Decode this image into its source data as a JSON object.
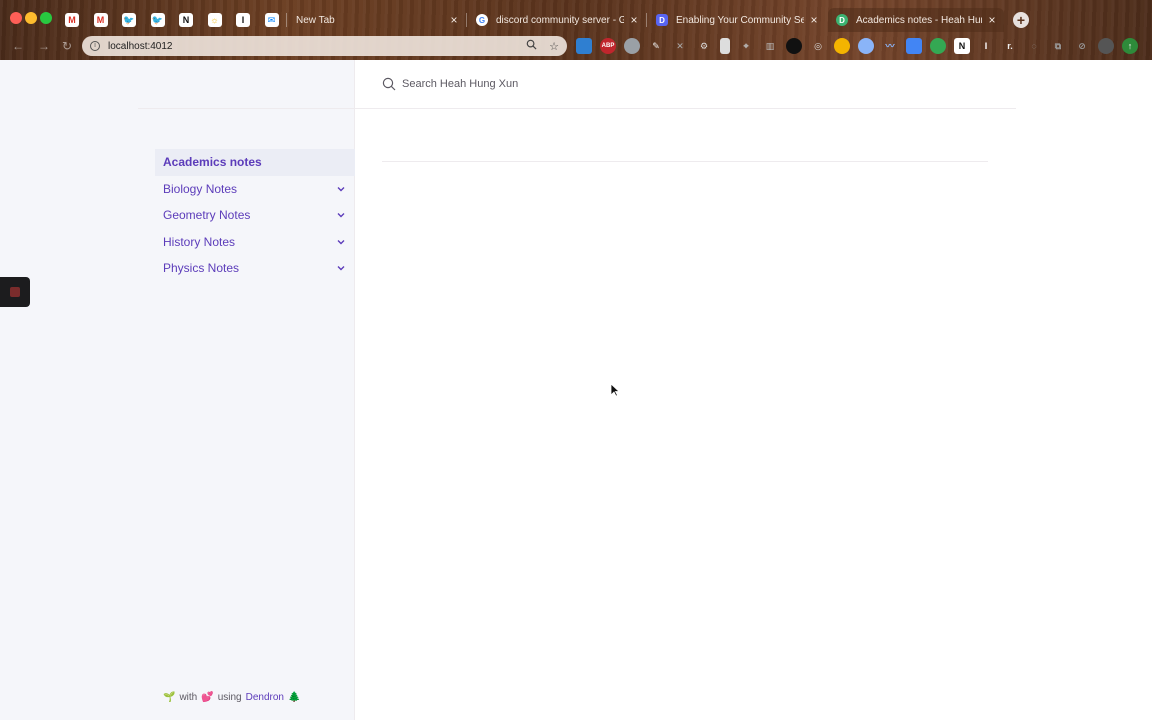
{
  "browser": {
    "pinned_tabs": [
      {
        "icon": "gmail-icon",
        "glyph": "M",
        "color": "#d93025"
      },
      {
        "icon": "gmail-icon",
        "glyph": "M",
        "color": "#d93025"
      },
      {
        "icon": "twitter-icon",
        "glyph": "🐦",
        "color": "#1da1f2"
      },
      {
        "icon": "twitter-icon",
        "glyph": "🐦",
        "color": "#1da1f2"
      },
      {
        "icon": "notion-icon",
        "glyph": "N",
        "color": "#111111"
      },
      {
        "icon": "sun-icon",
        "glyph": "☼",
        "color": "#f2b705"
      },
      {
        "icon": "instapaper-icon",
        "glyph": "I",
        "color": "#111111"
      },
      {
        "icon": "messenger-icon",
        "glyph": "✉",
        "color": "#0084ff"
      }
    ],
    "tabs": [
      {
        "title": "New Tab",
        "close": "×",
        "favicon": ""
      },
      {
        "title": "discord community server - Go",
        "close": "×",
        "favicon": "G"
      },
      {
        "title": "Enabling Your Community Serv",
        "close": "×",
        "favicon": "D"
      },
      {
        "title": "Academics notes - Heah Hung",
        "close": "×",
        "favicon": "D"
      }
    ],
    "new_tab_label": "+",
    "url": "localhost:4012",
    "colors": {
      "active_tab": "#502d19",
      "accent": "#5c3cba"
    }
  },
  "sidebar": {
    "items": [
      {
        "label": "Academics notes",
        "active": true,
        "expandable": false
      },
      {
        "label": "Biology Notes",
        "active": false,
        "expandable": true
      },
      {
        "label": "Geometry Notes",
        "active": false,
        "expandable": true
      },
      {
        "label": "History Notes",
        "active": false,
        "expandable": true
      },
      {
        "label": "Physics Notes",
        "active": false,
        "expandable": true
      }
    ],
    "footer": {
      "emoji_seedling": "🌱",
      "with_text": "with",
      "emoji_heart": "💕",
      "using_text": "using",
      "link_text": "Dendron",
      "emoji_tree": "🌲"
    }
  },
  "search": {
    "placeholder": "Search Heah Hung Xun",
    "value": ""
  }
}
